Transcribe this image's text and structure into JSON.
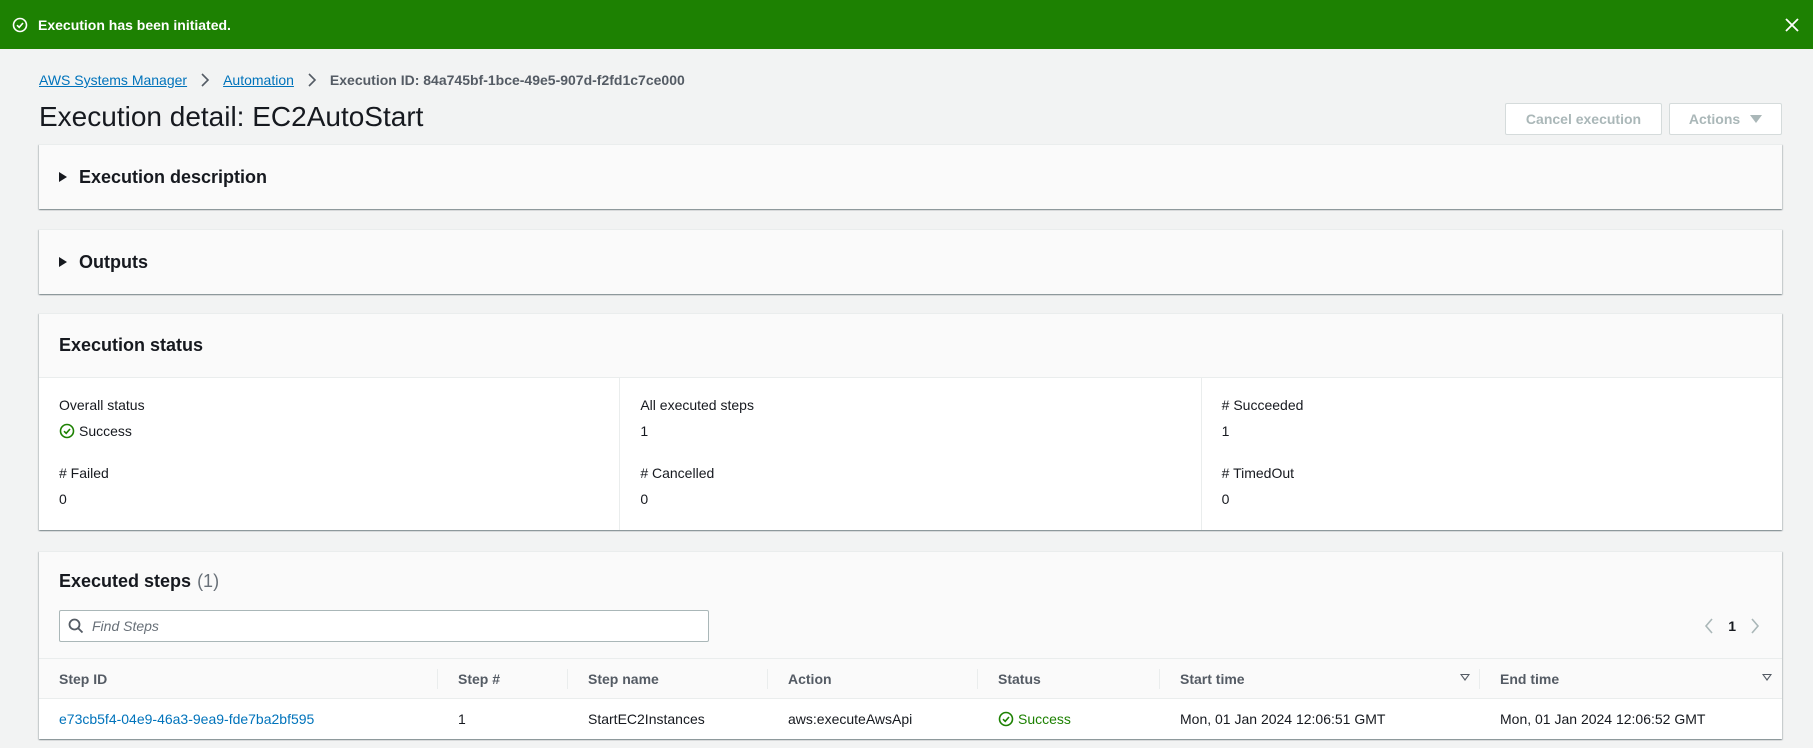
{
  "flash": {
    "message": "Execution has been initiated."
  },
  "breadcrumb": {
    "items": [
      "AWS Systems Manager",
      "Automation"
    ],
    "current": "Execution ID: 84a745bf-1bce-49e5-907d-f2fd1c7ce000"
  },
  "page": {
    "title": "Execution detail: EC2AutoStart",
    "cancel_label": "Cancel execution",
    "actions_label": "Actions"
  },
  "sections": {
    "description": "Execution description",
    "outputs": "Outputs"
  },
  "status": {
    "title": "Execution status",
    "overall_label": "Overall status",
    "overall_value": "Success",
    "all_steps_label": "All executed steps",
    "all_steps_value": "1",
    "succeeded_label": "# Succeeded",
    "succeeded_value": "1",
    "failed_label": "# Failed",
    "failed_value": "0",
    "cancelled_label": "# Cancelled",
    "cancelled_value": "0",
    "timedout_label": "# TimedOut",
    "timedout_value": "0"
  },
  "steps": {
    "title": "Executed steps",
    "count": "(1)",
    "search_placeholder": "Find Steps",
    "page": "1",
    "columns": [
      "Step ID",
      "Step #",
      "Step name",
      "Action",
      "Status",
      "Start time",
      "End time"
    ],
    "rows": [
      {
        "step_id": "e73cb5f4-04e9-46a3-9ea9-fde7ba2bf595",
        "step_num": "1",
        "step_name": "StartEC2Instances",
        "action": "aws:executeAwsApi",
        "status": "Success",
        "start": "Mon, 01 Jan 2024 12:06:51 GMT",
        "end": "Mon, 01 Jan 2024 12:06:52 GMT"
      }
    ]
  },
  "colors": {
    "success": "#1d8102",
    "link": "#0073bb"
  }
}
